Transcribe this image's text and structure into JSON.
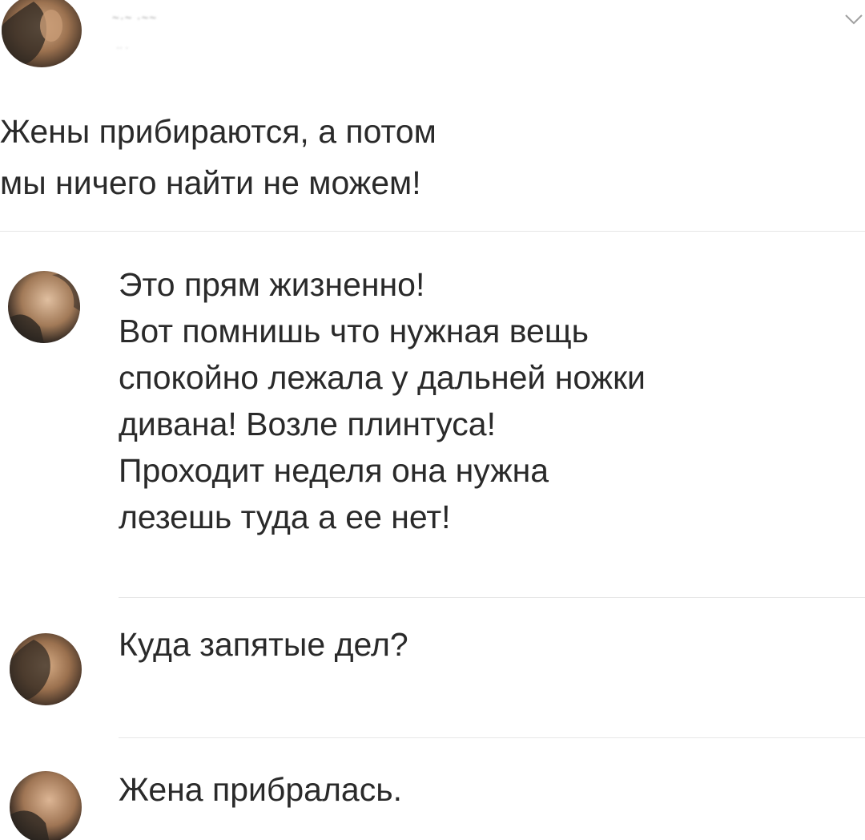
{
  "post": {
    "author_name": "~·~ ·~~",
    "author_meta": "·· ·",
    "text": "Жены прибираются, а потом\nмы ничего найти не можем!"
  },
  "comments": [
    {
      "text": "Это прям жизненно!\nВот помнишь что нужная вещь\nспокойно лежала у дальней ножки\nдивана! Возле плинтуса!\nПроходит неделя она нужна\nлезешь туда а ее нет!"
    },
    {
      "text": "Куда запятые дел?"
    },
    {
      "text": "Жена прибралась."
    }
  ],
  "icons": {
    "menu": "chevron-down-icon",
    "avatar": "avatar"
  },
  "colors": {
    "text": "#2a2a2a",
    "divider": "#e6e6e6",
    "avatar_warm": "#a8825e",
    "avatar_dark": "#2b2520"
  }
}
